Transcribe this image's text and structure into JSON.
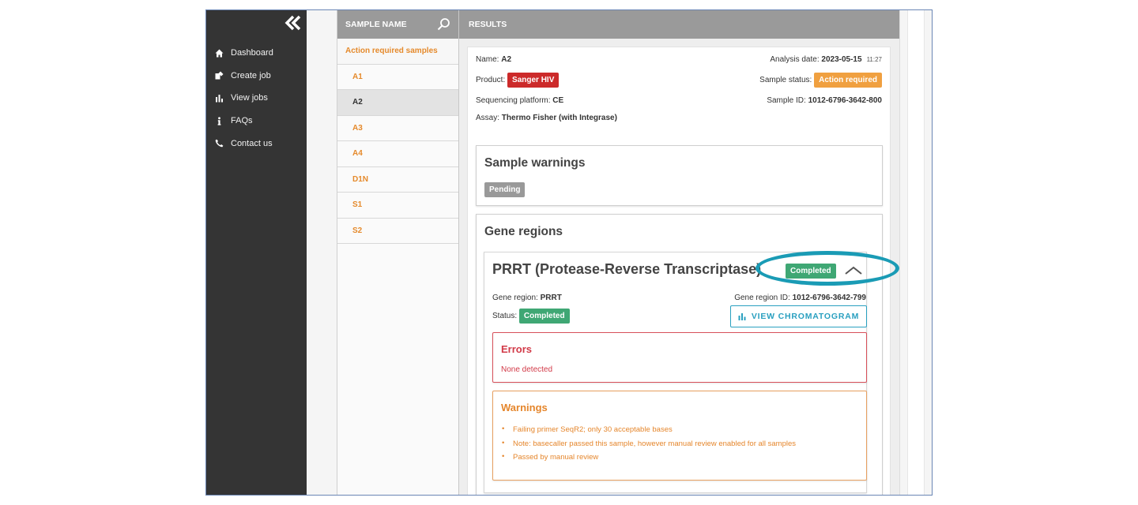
{
  "sidebar": {
    "items": [
      {
        "icon": "home-icon",
        "label": "Dashboard"
      },
      {
        "icon": "create-job-icon",
        "label": "Create job"
      },
      {
        "icon": "bar-chart-icon",
        "label": "View jobs"
      },
      {
        "icon": "info-icon",
        "label": "FAQs"
      },
      {
        "icon": "phone-icon",
        "label": "Contact us"
      }
    ]
  },
  "samples": {
    "header": "SAMPLE NAME",
    "section_label": "Action required samples",
    "items": [
      "A1",
      "A2",
      "A3",
      "A4",
      "D1N",
      "S1",
      "S2"
    ],
    "selected": "A2"
  },
  "results": {
    "header": "RESULTS",
    "name_label": "Name:",
    "name_value": "A2",
    "analysis_date_label": "Analysis date:",
    "analysis_date_value": "2023-05-15",
    "analysis_time": "11:27",
    "product_label": "Product:",
    "product_value": "Sanger HIV",
    "sample_status_label": "Sample status:",
    "sample_status_value": "Action required",
    "platform_label": "Sequencing platform:",
    "platform_value": "CE",
    "sample_id_label": "Sample ID:",
    "sample_id_value": "1012-6796-3642-800",
    "assay_label": "Assay:",
    "assay_value": "Thermo Fisher (with Integrase)"
  },
  "sample_warnings": {
    "title": "Sample warnings",
    "status": "Pending"
  },
  "gene_regions": {
    "title": "Gene regions",
    "card": {
      "title": "PRRT (Protease-Reverse Transcriptase)",
      "status_badge": "Completed",
      "gene_region_label": "Gene region:",
      "gene_region_value": "PRRT",
      "gene_region_id_label": "Gene region ID:",
      "gene_region_id_value": "1012-6796-3642-799",
      "status_label": "Status:",
      "status_value": "Completed",
      "chromatogram_button": "VIEW CHROMATOGRAM",
      "errors": {
        "title": "Errors",
        "text": "None detected"
      },
      "warnings": {
        "title": "Warnings",
        "items": [
          "Failing primer SeqR2; only 30 acceptable bases",
          "Note: basecaller passed this sample, however manual review enabled for all samples",
          "Passed by manual review"
        ]
      }
    }
  },
  "colors": {
    "sidebar_bg": "#343434",
    "accent_orange": "#e58a2c",
    "product_red": "#cc2a2a",
    "status_green": "#3fa774",
    "action_orange": "#f0a040",
    "error_red": "#d23a48",
    "chromatogram_teal": "#2aa0c0",
    "highlight_teal": "#1a9bb5"
  }
}
